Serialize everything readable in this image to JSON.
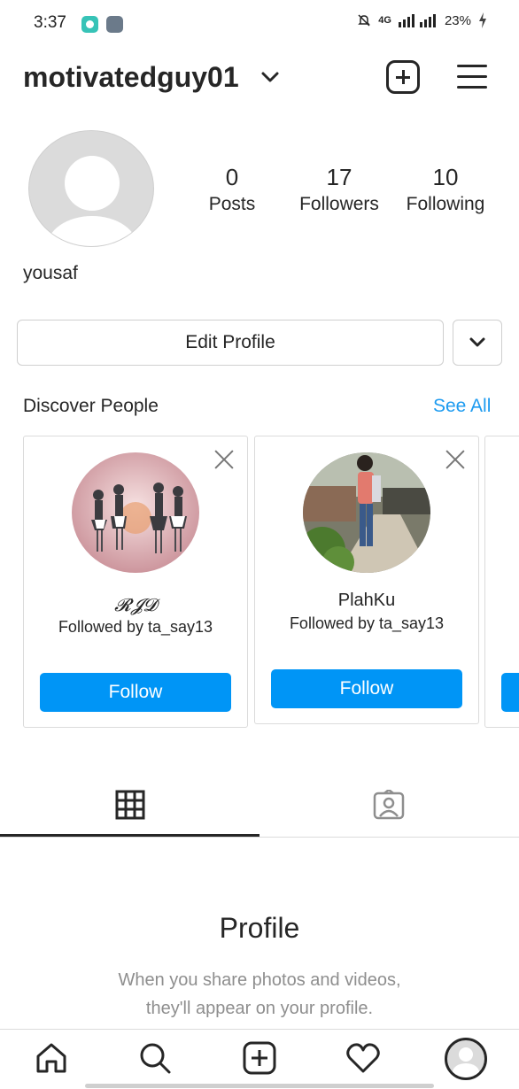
{
  "status_bar": {
    "time": "3:37",
    "battery": "23%",
    "network": "4G",
    "icons": [
      "app-notification-icon",
      "gallery-icon",
      "mute-icon",
      "signal-icon",
      "battery-icon"
    ]
  },
  "header": {
    "username": "motivatedguy01",
    "icons": [
      "chevron-down-icon",
      "new-post-icon",
      "menu-icon"
    ]
  },
  "profile": {
    "display_name": "yousaf",
    "stats": {
      "posts": {
        "value": "0",
        "label": "Posts"
      },
      "followers": {
        "value": "17",
        "label": "Followers"
      },
      "following": {
        "value": "10",
        "label": "Following"
      }
    }
  },
  "actions": {
    "edit_profile_label": "Edit Profile"
  },
  "discover": {
    "title": "Discover People",
    "see_all_label": "See All",
    "cards": [
      {
        "name": "𝓡𝓙𝓓",
        "subtitle": "Followed by ta_say13",
        "button_label": "Follow"
      },
      {
        "name": "PlahKu",
        "subtitle": "Followed by ta_say13",
        "button_label": "Follow"
      }
    ]
  },
  "empty_state": {
    "title": "Profile",
    "line1": "When you share photos and videos,",
    "line2": "they'll appear on your profile."
  },
  "bottom_nav": {
    "items": [
      "home-icon",
      "search-icon",
      "create-icon",
      "activity-icon",
      "profile-avatar"
    ]
  },
  "colors": {
    "accent": "#0095f6",
    "link": "#1d9bf0",
    "text": "#262626",
    "muted": "#8e8e8e",
    "border": "#dbdbdb"
  }
}
